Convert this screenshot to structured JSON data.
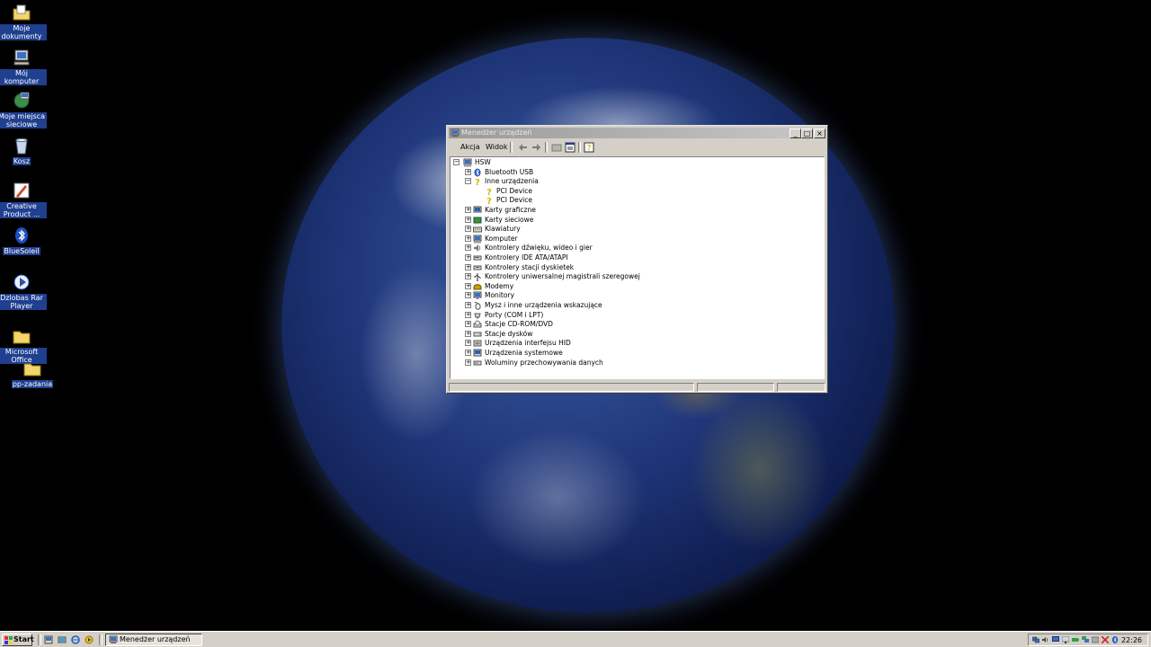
{
  "desktop": {
    "icons": [
      {
        "label": "Moje dokumenty",
        "icon": "folder-documents-icon"
      },
      {
        "label": "Mój komputer",
        "icon": "computer-icon"
      },
      {
        "label": "Moje miejsca sieciowe",
        "icon": "network-places-icon"
      },
      {
        "label": "Kosz",
        "icon": "recycle-bin-icon"
      },
      {
        "label": "Creative Product ...",
        "icon": "creative-product-icon"
      },
      {
        "label": "BlueSoleil",
        "icon": "bluetooth-icon"
      },
      {
        "label": "Dzlobas Rar Player",
        "icon": "media-player-icon"
      },
      {
        "label": "Microsoft Office",
        "icon": "folder-icon"
      },
      {
        "label": "pp-zadania",
        "icon": "folder-icon"
      }
    ]
  },
  "window": {
    "title": "Menedżer urządzeń",
    "controls": {
      "minimize": "_",
      "maximize": "□",
      "close": "×"
    },
    "menu": {
      "action": "Akcja",
      "view": "Widok"
    },
    "toolbar": [
      "back-icon",
      "forward-icon",
      "up-icon",
      "properties-icon",
      "help-icon"
    ],
    "tree": {
      "root": "HSW",
      "nodes": [
        {
          "label": "Bluetooth USB",
          "expand": "+"
        },
        {
          "label": "Inne urządzenia",
          "expand": "−"
        },
        {
          "label": "PCI Device",
          "child": true
        },
        {
          "label": "PCI Device",
          "child": true
        },
        {
          "label": "Karty graficzne",
          "expand": "+"
        },
        {
          "label": "Karty sieciowe",
          "expand": "+"
        },
        {
          "label": "Klawiatury",
          "expand": "+"
        },
        {
          "label": "Komputer",
          "expand": "+"
        },
        {
          "label": "Kontrolery dźwięku, wideo i gier",
          "expand": "+"
        },
        {
          "label": "Kontrolery IDE ATA/ATAPI",
          "expand": "+"
        },
        {
          "label": "Kontrolery stacji dyskietek",
          "expand": "+"
        },
        {
          "label": "Kontrolery uniwersalnej magistrali szeregowej",
          "expand": "+"
        },
        {
          "label": "Modemy",
          "expand": "+"
        },
        {
          "label": "Monitory",
          "expand": "+"
        },
        {
          "label": "Mysz i inne urządzenia wskazujące",
          "expand": "+"
        },
        {
          "label": "Porty (COM i LPT)",
          "expand": "+"
        },
        {
          "label": "Stacje CD-ROM/DVD",
          "expand": "+"
        },
        {
          "label": "Stacje dysków",
          "expand": "+"
        },
        {
          "label": "Urządzenia interfejsu HID",
          "expand": "+"
        },
        {
          "label": "Urządzenia systemowe",
          "expand": "+"
        },
        {
          "label": "Woluminy przechowywania danych",
          "expand": "+"
        }
      ]
    }
  },
  "taskbar": {
    "start_label": "Start",
    "task_label": "Menedżer urządzeń",
    "clock": "22:26"
  }
}
